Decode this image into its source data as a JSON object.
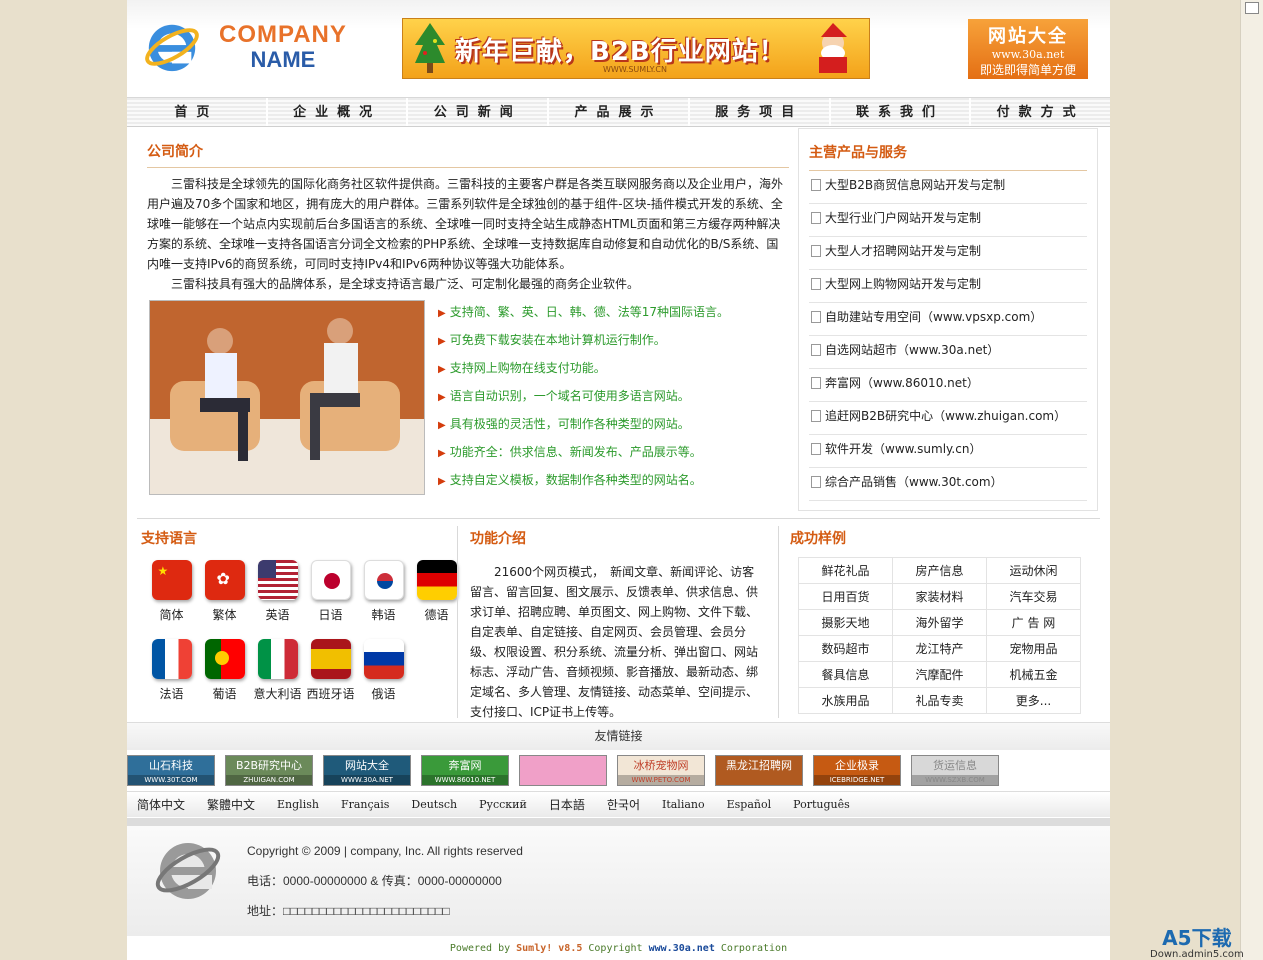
{
  "header": {
    "logo_line1": "COMPANY",
    "logo_line2": "NAME",
    "banner_text": "新年巨献，B2B行业网站！",
    "banner_url": "WWW.SUMLY.CN",
    "ad_title": "网站大全",
    "ad_url": "www.30a.net",
    "ad_slogan": "即选即得简单方便"
  },
  "nav": [
    "首页",
    "企业概况",
    "公司新闻",
    "产品展示",
    "服务项目",
    "联系我们",
    "付款方式"
  ],
  "intro": {
    "title": "公司简介",
    "para1": "三雷科技是全球领先的国际化商务社区软件提供商。三雷科技的主要客户群是各类互联网服务商以及企业用户，海外用户遍及70多个国家和地区，拥有庞大的用户群体。三雷系列软件是全球独创的基于组件-区块-插件模式开发的系统、全球唯一能够在一个站点内实现前后台多国语言的系统、全球唯一同时支持全站生成静态HTML页面和第三方缓存两种解决方案的系统、全球唯一支持各国语言分词全文检索的PHP系统、全球唯一支持数据库自动修复和自动优化的B/S系统、国内唯一支持IPv6的商贸系统，可同时支持IPv4和IPv6两种协议等强大功能体系。",
    "para2": "三雷科技具有强大的品牌体系，是全球支持语言最广泛、可定制化最强的商务企业软件。",
    "features": [
      "支持简、繁、英、日、韩、德、法等17种国际语言。",
      "可免费下载安装在本地计算机运行制作。",
      "支持网上购物在线支付功能。",
      "语言自动识别，一个域名可使用多语言网站。",
      "具有极强的灵活性，可制作各种类型的网站。",
      "功能齐全：供求信息、新闻发布、产品展示等。",
      "支持自定义模板，数据制作各种类型的网站名。"
    ]
  },
  "services": {
    "title": "主营产品与服务",
    "items": [
      "大型B2B商贸信息网站开发与定制",
      "大型行业门户网站开发与定制",
      "大型人才招聘网站开发与定制",
      "大型网上购物网站开发与定制",
      "自助建站专用空间（www.vpsxp.com）",
      "自选网站超市（www.30a.net）",
      "奔富网（www.86010.net）",
      "追赶网B2B研究中心（www.zhuigan.com）",
      "软件开发（www.sumly.cn）",
      "综合产品销售（www.30t.com）"
    ]
  },
  "languages": {
    "title": "支持语言",
    "items": [
      "简体",
      "繁体",
      "英语",
      "日语",
      "韩语",
      "德语",
      "法语",
      "葡语",
      "意大利语",
      "西班牙语",
      "俄语"
    ]
  },
  "functions": {
    "title": "功能介绍",
    "text": "21600个网页模式，　新闻文章、新闻评论、访客留言、留言回复、图文展示、反馈表单、供求信息、供求订单、招聘应聘、单页图文、网上购物、文件下载、自定表单、自定链接、自定网页、会员管理、会员分级、权限设置、积分系统、流量分析、弹出窗口、网站标志、浮动广告、音频视频、影音播放、最新动态、绑定域名、多人管理、友情链接、动态菜单、空间提示、支付接口、ICP证书上传等。"
  },
  "cases": {
    "title": "成功样例",
    "rows": [
      [
        "鲜花礼品",
        "房产信息",
        "运动休闲"
      ],
      [
        "日用百货",
        "家装材料",
        "汽车交易"
      ],
      [
        "摄影天地",
        "海外留学",
        "广 告 网"
      ],
      [
        "数码超市",
        "龙江特产",
        "宠物用品"
      ],
      [
        "餐具信息",
        "汽摩配件",
        "机械五金"
      ],
      [
        "水族用品",
        "礼品专卖",
        "更多..."
      ]
    ]
  },
  "links": {
    "title": "友情链接",
    "logos": [
      {
        "name": "山石科技",
        "sub": "WWW.30T.COM",
        "color": "#2f6f9a"
      },
      {
        "name": "B2B研究中心",
        "sub": "ZHUIGAN.COM",
        "color": "#6b8a5a"
      },
      {
        "name": "网站大全",
        "sub": "WWW.30A.NET",
        "color": "#1f5a7a"
      },
      {
        "name": "奔富网",
        "sub": "WWW.86010.NET",
        "color": "#3a9a3a"
      },
      {
        "name": "",
        "sub": "",
        "color": "#f0a0c8"
      },
      {
        "name": "冰桥宠物网",
        "sub": "WWW.PETO.COM",
        "color": "#f2e6d6"
      },
      {
        "name": "黑龙江招聘网",
        "sub": "",
        "color": "#b05a20"
      },
      {
        "name": "企业极录",
        "sub": "ICEBRIDGE.NET",
        "color": "#c65a12"
      },
      {
        "name": "货运信息",
        "sub": "WWW.SZXB.COM",
        "color": "#d8d8d8"
      }
    ]
  },
  "language_bar": [
    "简体中文",
    "繁體中文",
    "English",
    "Français",
    "Deutsch",
    "Русский",
    "日本語",
    "한국어",
    "Italiano",
    "Español",
    "Português"
  ],
  "footer": {
    "copyright": "Copyright © 2009 | company, Inc. All rights reserved",
    "phone": "电话：0000-00000000 & 传真：0000-00000000",
    "address": "地址：□□□□□□□□□□□□□□□□□□□□□□□"
  },
  "powered": {
    "prefix": "Powered by ",
    "brand": "Sumly! v8.5",
    "middle": " Copyright ",
    "site": "www.30a.net",
    "suffix": " Corporation"
  },
  "watermark": {
    "line1": "A5下载",
    "line2": "Down.admin5.com"
  }
}
